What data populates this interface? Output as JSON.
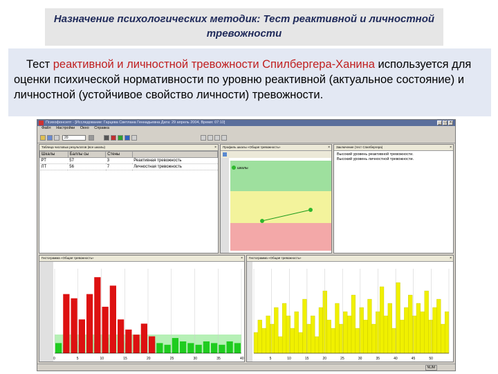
{
  "slide": {
    "title": "Назначение психологических методик: Тест реактивной и личностной тревожности",
    "description": {
      "part1": "Тест ",
      "highlight": "реактивной и личностной тревожности Спилбергера-Ханина",
      "part2": " используется для оценки психической нормативности по уровню реактивной (актуальное состояние) и личностной (устойчивое свойство личности) тревожности."
    }
  },
  "app": {
    "window_title": "Психофонсепт - [Исследование: Гарцева Светлана Геннадьевна Дата: 29 апрель 2004, Время: 07:10]",
    "menu": [
      "Файл",
      "Настройки",
      "Окно",
      "Справка"
    ],
    "toolbar_field": "20",
    "table_pane": {
      "title": "Таблица числовых результатов (все шкалы)",
      "columns": [
        "Шкалы",
        "Баллы сы",
        "Стены",
        ""
      ],
      "rows": [
        {
          "scale": "РТ",
          "raw": "57",
          "sten": "3",
          "label": "Реактивная тревожность"
        },
        {
          "scale": "ЛТ",
          "raw": "56",
          "sten": "7",
          "label": "Личностная тревожность"
        }
      ]
    },
    "profile_pane": {
      "title": "Профиль шкалы «Общая тревожность»",
      "legend_item": "шкалы",
      "colors": {
        "green_zone": "#9ee09e",
        "yellow_zone": "#f3f39c",
        "red_zone": "#f3a8a8",
        "line": "#1a9a1a"
      }
    },
    "conclusion_pane": {
      "title": "Заключение (тест Спилбергера)",
      "lines": [
        "Высокий уровень реактивной тревожности.",
        "Высокий уровень личностной тревожности."
      ]
    },
    "bar_pane_left": {
      "title": "Гистограмма «Общая тревожность»",
      "colors": {
        "bars_high": "#dd1111",
        "bars_low": "#1fcc1f",
        "background": "#b6f0b6"
      }
    },
    "bar_pane_right": {
      "title": "Гистограмма «Общая тревожность»",
      "colors": {
        "bars": "#f0f000"
      }
    },
    "status": {
      "indicator": "NUM"
    }
  },
  "chart_data": [
    {
      "type": "bar",
      "pane": "bar_pane_left",
      "x_ticks": [
        "0",
        "5",
        "10",
        "15",
        "20",
        "25",
        "30",
        "35",
        "40"
      ],
      "values_red": [
        0,
        70,
        65,
        40,
        70,
        90,
        55,
        80,
        40,
        28,
        22,
        35,
        20
      ],
      "values_green": [
        12,
        10,
        14,
        10,
        16,
        12,
        18,
        10,
        14,
        12,
        16,
        10,
        14,
        12,
        10,
        18,
        14,
        12,
        10,
        14,
        12,
        10,
        14,
        12
      ]
    },
    {
      "type": "bar",
      "pane": "bar_pane_right",
      "x_ticks": [
        "5",
        "10",
        "15",
        "20",
        "25",
        "30",
        "35",
        "40",
        "45",
        "50"
      ],
      "values": [
        25,
        40,
        30,
        45,
        35,
        55,
        20,
        60,
        45,
        30,
        50,
        25,
        65,
        35,
        45,
        20,
        55,
        75,
        40,
        30,
        60,
        35,
        50,
        45,
        70,
        30,
        55,
        40,
        65,
        35,
        50,
        80,
        45,
        60,
        30,
        85,
        40,
        55,
        70,
        45,
        60,
        50,
        75,
        40,
        55,
        65,
        35,
        50
      ]
    }
  ]
}
